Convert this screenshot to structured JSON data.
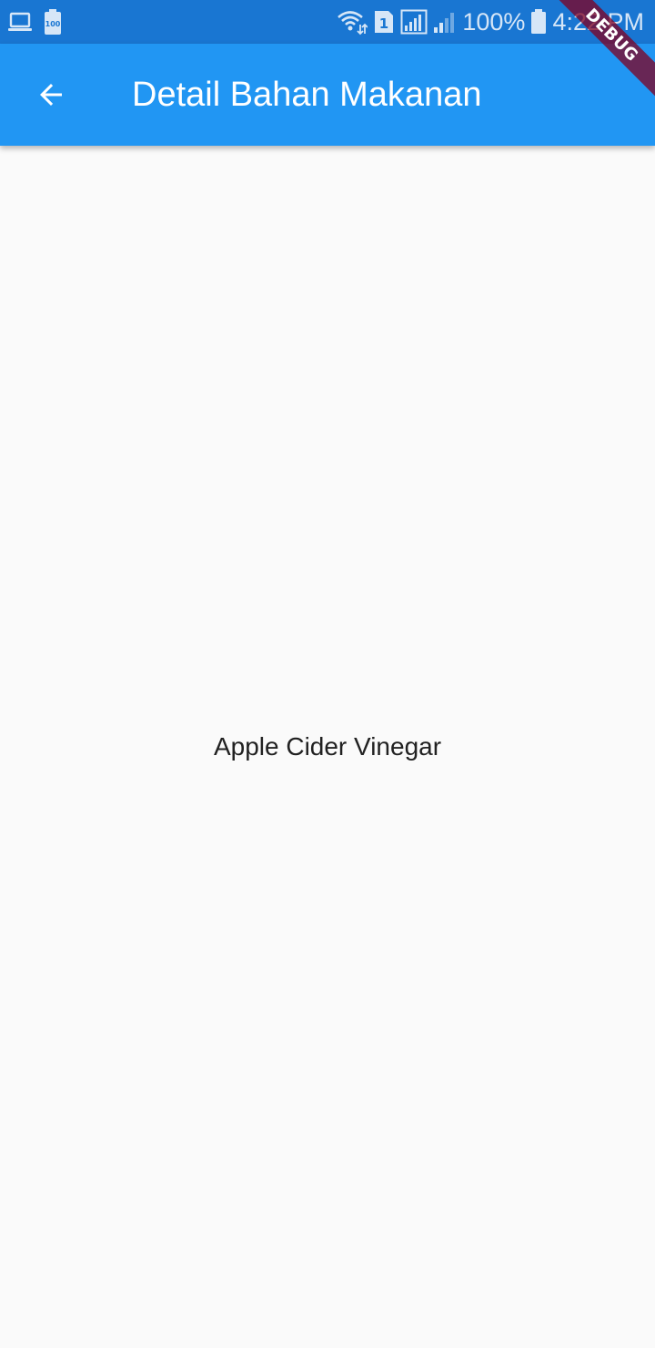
{
  "status_bar": {
    "left_icons": [
      "laptop-icon",
      "battery-100-notification-icon"
    ],
    "right_icons": [
      "wifi-data-icon",
      "sim-1-icon",
      "signal-strength-icon",
      "signal-strength-2-icon",
      "battery-icon"
    ],
    "sim_label": "1",
    "battery_notif_label": "100",
    "battery_percent": "100%",
    "time": "4:22 PM"
  },
  "app_bar": {
    "back_icon": "arrow-back-icon",
    "title": "Detail Bahan Makanan"
  },
  "content": {
    "item_name": "Apple Cider Vinegar"
  },
  "debug_banner": {
    "label": "DEBUG"
  },
  "colors": {
    "status_bar": "#1976d2",
    "app_bar": "#2196f3",
    "background": "#fafafa",
    "text_primary": "#212121",
    "debug_banner": "#800020"
  }
}
